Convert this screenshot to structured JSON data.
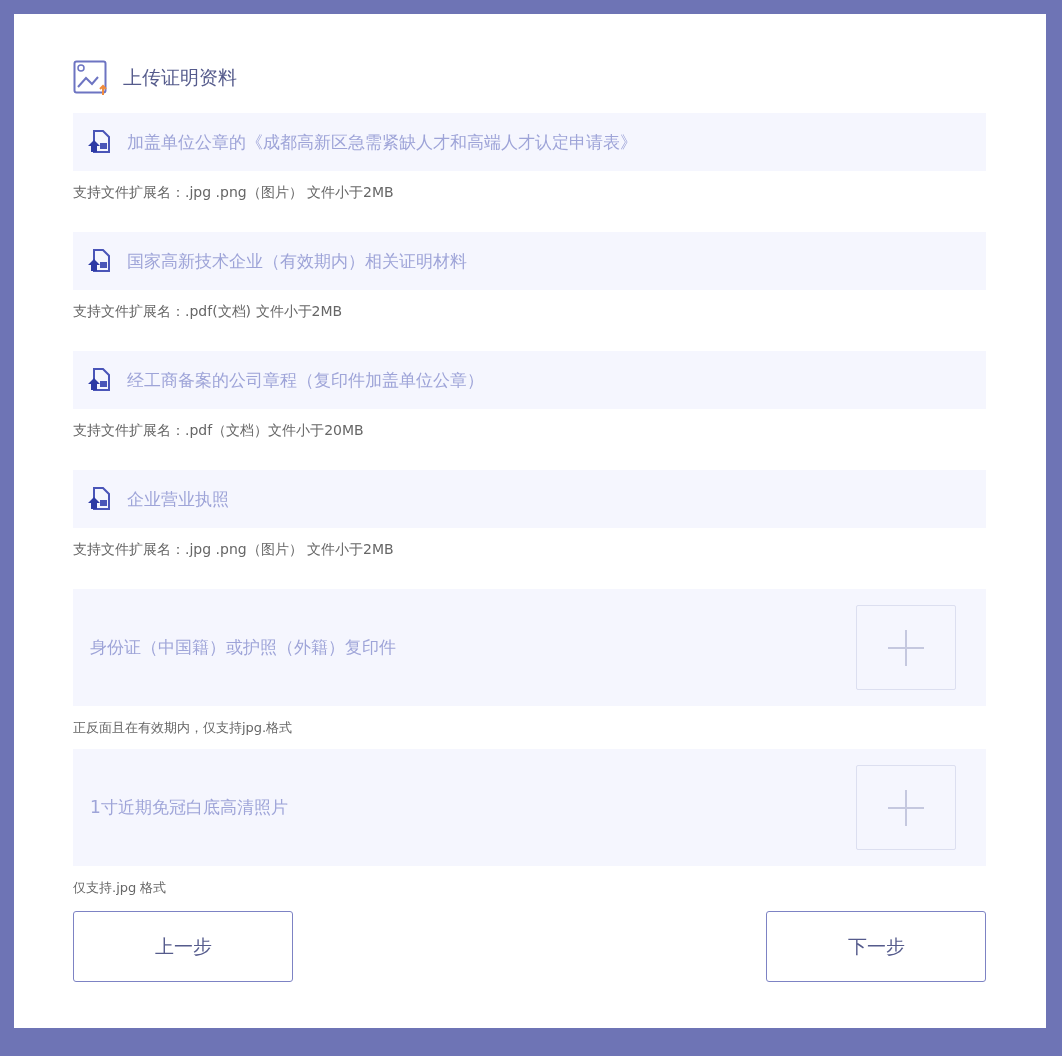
{
  "title": "上传证明资料",
  "items": [
    {
      "kind": "file",
      "label": "加盖单位公章的《成都高新区急需紧缺人才和高端人才认定申请表》",
      "hint": "支持文件扩展名：.jpg .png（图片） 文件小于2MB"
    },
    {
      "kind": "file",
      "label": "国家高新技术企业（有效期内）相关证明材料",
      "hint": "支持文件扩展名：.pdf(文档) 文件小于2MB"
    },
    {
      "kind": "file",
      "label": "经工商备案的公司章程（复印件加盖单位公章）",
      "hint": "支持文件扩展名：.pdf（文档）文件小于20MB"
    },
    {
      "kind": "file",
      "label": "企业营业执照",
      "hint": "支持文件扩展名：.jpg .png（图片） 文件小于2MB"
    },
    {
      "kind": "photo",
      "label": "身份证（中国籍）或护照（外籍）复印件",
      "hint": "正反面且在有效期内，仅支持jpg.格式"
    },
    {
      "kind": "photo",
      "label": "1寸近期免冠白底高清照片",
      "hint": "仅支持.jpg 格式"
    }
  ],
  "buttons": {
    "prev": "上一步",
    "next": "下一步"
  }
}
